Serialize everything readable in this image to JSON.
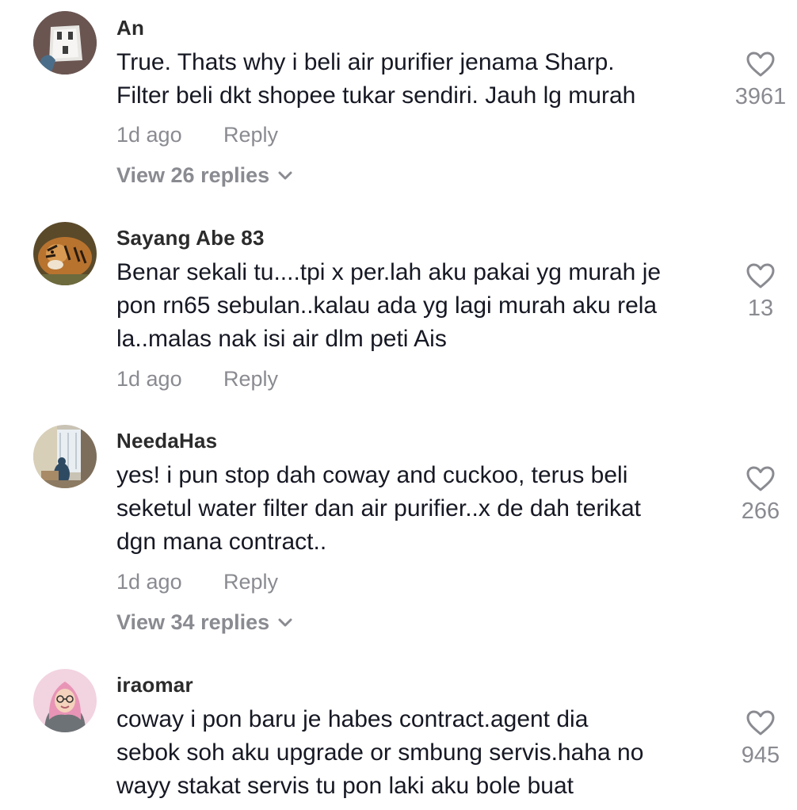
{
  "comments": [
    {
      "username": "An",
      "avatar_icon": "plug-avatar-icon",
      "lines": [
        "True. Thats why i beli air purifier jenama Sharp.",
        "Filter beli dkt shopee tukar sendiri. Jauh lg murah"
      ],
      "time": "1d ago",
      "reply_label": "Reply",
      "view_replies": "View 26 replies",
      "likes": "3961"
    },
    {
      "username": "Sayang Abe 83",
      "avatar_icon": "tiger-avatar-icon",
      "lines": [
        "Benar sekali tu....tpi x per.lah aku pakai yg murah je",
        "pon rn65 sebulan..kalau ada yg lagi murah aku rela",
        "la..malas nak isi air dlm peti Ais"
      ],
      "time": "1d ago",
      "reply_label": "Reply",
      "likes": "13"
    },
    {
      "username": "NeedaHas",
      "avatar_icon": "room-photo-avatar-icon",
      "lines": [
        "yes! i pun stop dah coway and cuckoo, terus beli",
        "seketul water filter dan air purifier..x de dah terikat",
        "dgn mana contract.."
      ],
      "time": "1d ago",
      "reply_label": "Reply",
      "view_replies": "View 34 replies",
      "likes": "266"
    },
    {
      "username": "iraomar",
      "avatar_icon": "hijab-cartoon-avatar-icon",
      "lines": [
        "coway i pon baru je habes contract.agent dia",
        "sebok soh aku upgrade or smbung servis.haha no",
        "wayy stakat servis tu pon laki aku bole buat"
      ],
      "likes": "945"
    }
  ],
  "colors": {
    "username": "#2b2b2b",
    "text": "#161823",
    "secondary": "#8a8b91",
    "background": "#ffffff"
  }
}
